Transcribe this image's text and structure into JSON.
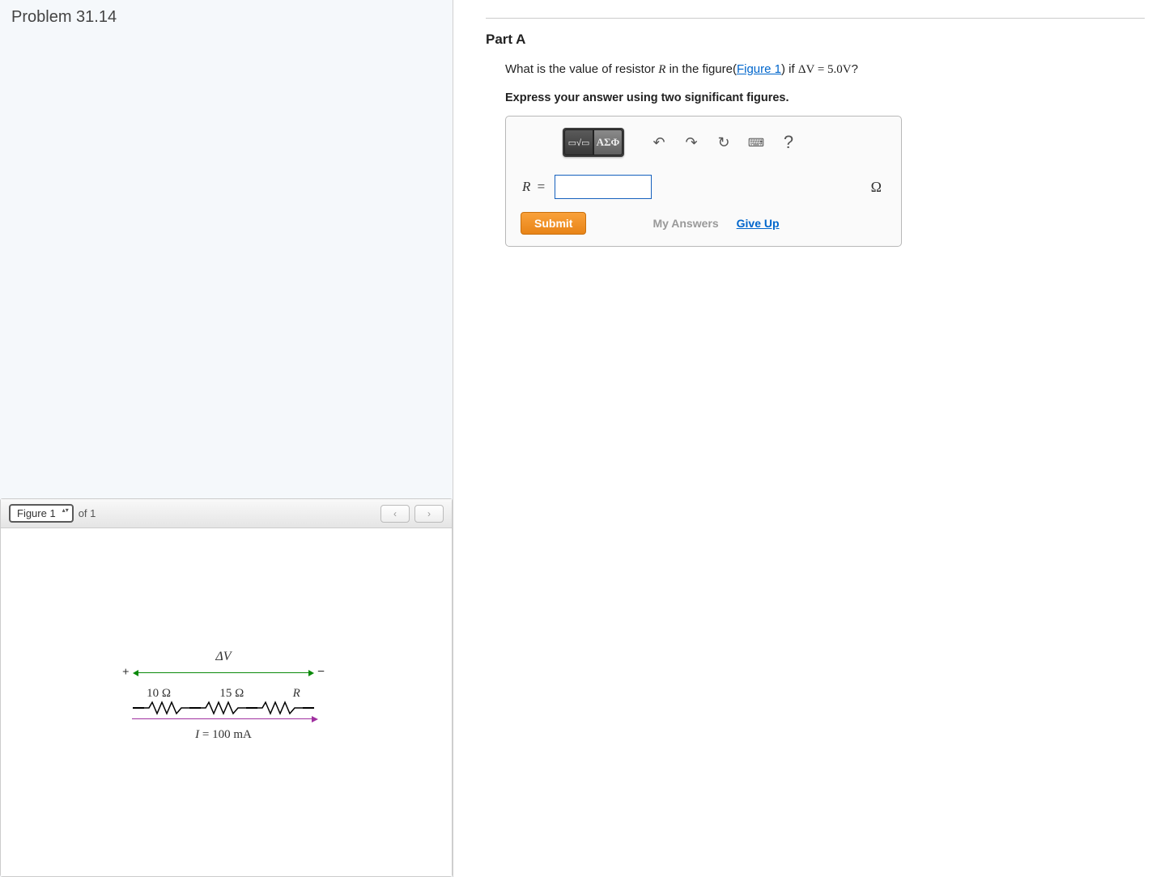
{
  "problem": {
    "title": "Problem 31.14"
  },
  "figure": {
    "selector_label": "Figure 1",
    "of_label": "of 1",
    "prev_glyph": "‹",
    "next_glyph": "›",
    "diagram": {
      "dv_label": "ΔV",
      "plus": "+",
      "minus": "−",
      "r1_label": "10 Ω",
      "r2_label": "15 Ω",
      "r3_label": "R",
      "current_var": "I",
      "current_eq": " = 100 mA"
    }
  },
  "part": {
    "heading": "Part A",
    "q_prefix": "What is the value of resistor ",
    "q_var": "R",
    "q_mid": " in the figure(",
    "q_link": "Figure 1",
    "q_suffix": ") if ",
    "q_dv": "ΔV",
    "q_eq": " = 5.0V",
    "q_end": "?",
    "instructions": "Express your answer using two significant figures."
  },
  "toolbar": {
    "templates_glyph": "▭√▭",
    "greek_glyph": "ΑΣΦ",
    "undo_glyph": "↶",
    "redo_glyph": "↷",
    "reset_glyph": "↻",
    "keyboard_glyph": "⌨",
    "help_glyph": "?"
  },
  "answer": {
    "var": "R",
    "eq": "=",
    "value": "",
    "unit": "Ω"
  },
  "actions": {
    "submit": "Submit",
    "my_answers": "My Answers",
    "give_up": "Give Up"
  }
}
